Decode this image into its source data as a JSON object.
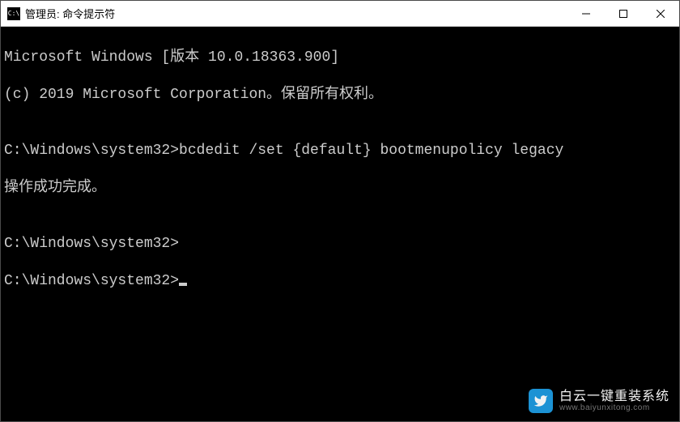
{
  "window": {
    "title": "管理员: 命令提示符",
    "icon_glyph": "C:\\"
  },
  "terminal": {
    "lines": [
      "Microsoft Windows [版本 10.0.18363.900]",
      "(c) 2019 Microsoft Corporation。保留所有权利。",
      "",
      "C:\\Windows\\system32>bcdedit /set {default} bootmenupolicy legacy",
      "操作成功完成。",
      "",
      "C:\\Windows\\system32>",
      "C:\\Windows\\system32>"
    ]
  },
  "watermark": {
    "main": "白云一键重装系统",
    "sub": "www.baiyunxitong.com"
  },
  "controls": {
    "minimize": "minimize",
    "maximize": "maximize",
    "close": "close"
  }
}
